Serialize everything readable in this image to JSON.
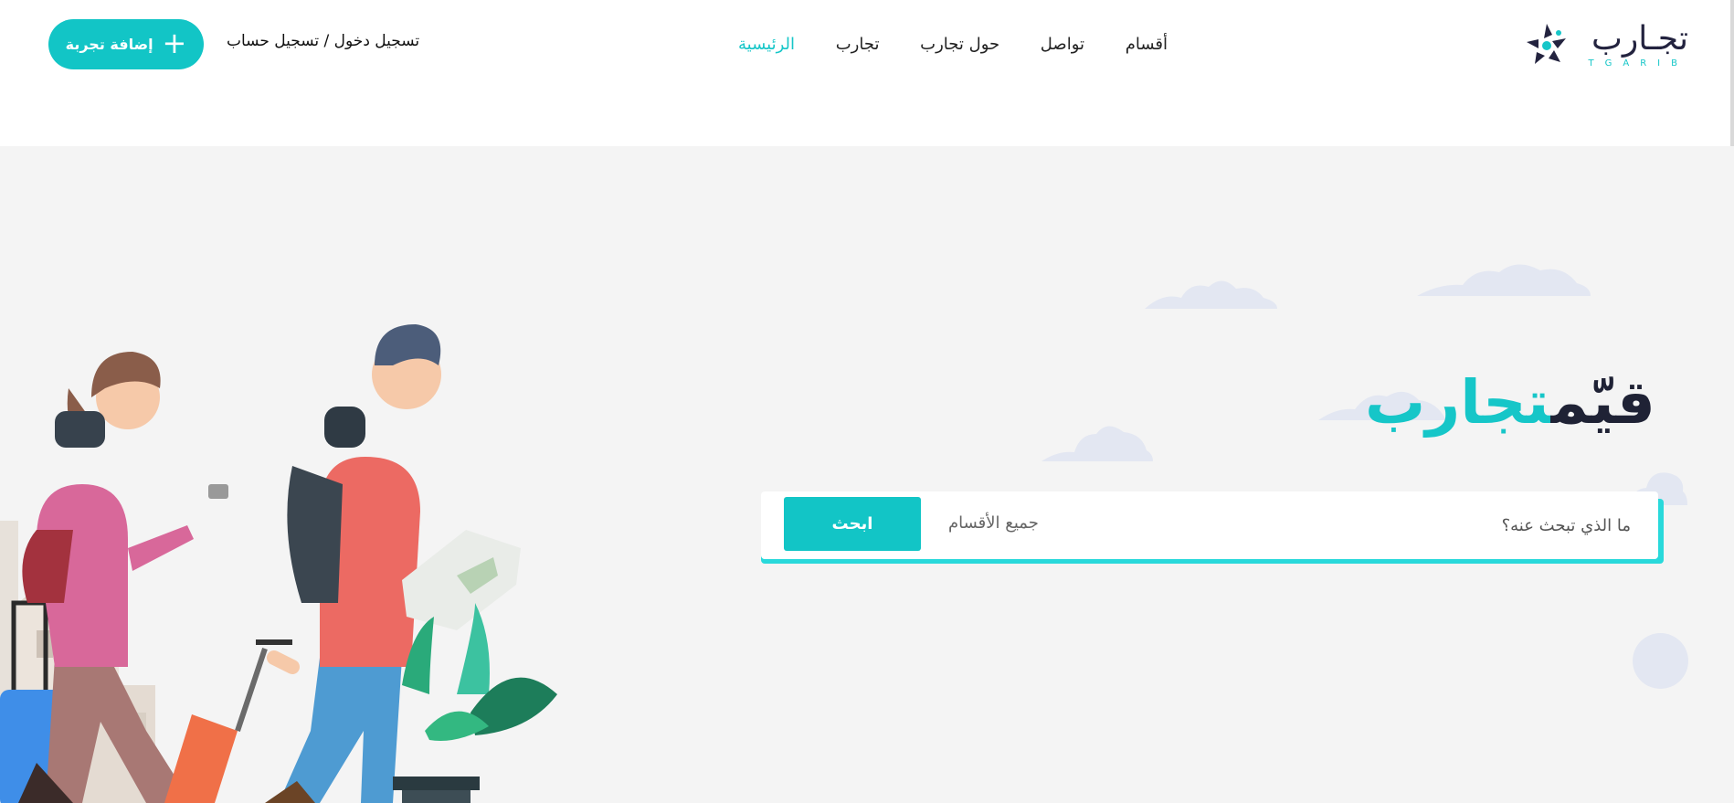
{
  "brand": {
    "name_ar": "تجـارب",
    "name_latin": "TGARIB",
    "accent_color": "#16c6c8",
    "dark_color": "#23233f"
  },
  "nav": {
    "items": [
      {
        "label": "الرئيسية",
        "active": true
      },
      {
        "label": "تجارب",
        "active": false
      },
      {
        "label": "حول تجارب",
        "active": false
      },
      {
        "label": "تواصل",
        "active": false
      },
      {
        "label": "أقسام",
        "active": false
      }
    ]
  },
  "header": {
    "login_label": "تسجيل دخول / تسجيل حساب",
    "add_button_label": "إضافة تجربة",
    "add_icon": "plus-icon"
  },
  "hero": {
    "title_main": "قيّم",
    "title_accent": "تجارب",
    "search_placeholder": "ما الذي تبحث عنه؟",
    "category_selected": "جميع الأقسام",
    "search_button_label": "ابحث",
    "background_color": "#f4f4f4"
  }
}
